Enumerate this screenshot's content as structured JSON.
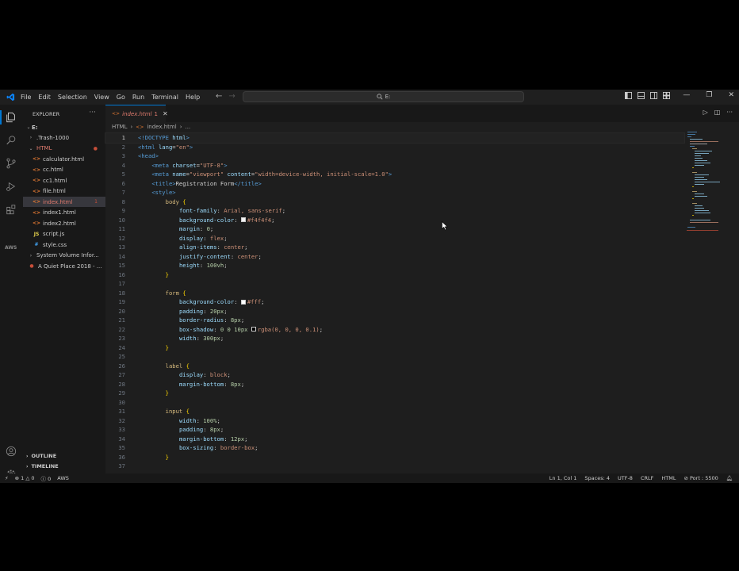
{
  "menu": [
    "File",
    "Edit",
    "Selection",
    "View",
    "Go",
    "Run",
    "Terminal",
    "Help"
  ],
  "search": {
    "text": "E:"
  },
  "colors": {
    "accent": "#0078d4",
    "modified": "#e07b6e",
    "html_icon": "#e37933",
    "js_icon": "#e8d44d",
    "css_icon": "#42a5f5",
    "tag": "#569cd6",
    "attr": "#9cdcfe",
    "string": "#ce9178",
    "property": "#9cdcfe",
    "value": "#ce9178",
    "number": "#b5cea8",
    "punct": "#808080",
    "selector": "#d7ba7d",
    "brace": "#ffd700"
  },
  "explorer": {
    "title": "EXPLORER",
    "more": "···",
    "root": "E:",
    "items": [
      {
        "label": ".Trash-1000",
        "type": "folder",
        "open": false,
        "indent": 1
      },
      {
        "label": "HTML",
        "type": "folder",
        "open": true,
        "indent": 1,
        "modified": true
      },
      {
        "label": "calculator.html",
        "type": "html",
        "indent": 2
      },
      {
        "label": "cc.html",
        "type": "html",
        "indent": 2
      },
      {
        "label": "cc1.html",
        "type": "html",
        "indent": 2
      },
      {
        "label": "file.html",
        "type": "html",
        "indent": 2
      },
      {
        "label": "index.html",
        "type": "html",
        "indent": 2,
        "selected": true,
        "badge": "1"
      },
      {
        "label": "index1.html",
        "type": "html",
        "indent": 2
      },
      {
        "label": "index2.html",
        "type": "html",
        "indent": 2
      },
      {
        "label": "script.js",
        "type": "js",
        "indent": 2
      },
      {
        "label": "style.css",
        "type": "css",
        "indent": 2
      },
      {
        "label": "System Volume Infor...",
        "type": "folder",
        "open": false,
        "indent": 1
      },
      {
        "label": "A Quiet Place 2018 - ...",
        "type": "video",
        "indent": 1
      }
    ],
    "outline": "OUTLINE",
    "timeline": "TIMELINE"
  },
  "tab": {
    "name": "index.html",
    "problems": "1",
    "close": "✕"
  },
  "breadcrumb": {
    "folder": "HTML",
    "sep": "›",
    "file": "index.html",
    "more": "..."
  },
  "code": [
    [
      [
        "tag",
        "<!DOCTYPE "
      ],
      [
        "attr",
        "html"
      ],
      [
        "tag",
        ">"
      ]
    ],
    [
      [
        "tag",
        "<html "
      ],
      [
        "attr",
        "lang"
      ],
      [
        "txt",
        "="
      ],
      [
        "string",
        "\"en\""
      ],
      [
        "tag",
        ">"
      ]
    ],
    [
      [
        "tag",
        "<head>"
      ]
    ],
    [
      [
        "txt",
        "    "
      ],
      [
        "tag",
        "<meta "
      ],
      [
        "attr",
        "charset"
      ],
      [
        "txt",
        "="
      ],
      [
        "string",
        "\"UTF-8\""
      ],
      [
        "tag",
        ">"
      ]
    ],
    [
      [
        "txt",
        "    "
      ],
      [
        "tag",
        "<meta "
      ],
      [
        "attr",
        "name"
      ],
      [
        "txt",
        "="
      ],
      [
        "string",
        "\"viewport\""
      ],
      [
        "txt",
        " "
      ],
      [
        "attr",
        "content"
      ],
      [
        "txt",
        "="
      ],
      [
        "string",
        "\"width=device-width, initial-scale=1.0\""
      ],
      [
        "tag",
        ">"
      ]
    ],
    [
      [
        "txt",
        "    "
      ],
      [
        "tag",
        "<title>"
      ],
      [
        "txt",
        "Registration Form"
      ],
      [
        "tag",
        "</title>"
      ]
    ],
    [
      [
        "txt",
        "    "
      ],
      [
        "tag",
        "<style>"
      ]
    ],
    [
      [
        "txt",
        "        "
      ],
      [
        "selector",
        "body"
      ],
      [
        "txt",
        " "
      ],
      [
        "brace",
        "{"
      ]
    ],
    [
      [
        "txt",
        "            "
      ],
      [
        "property",
        "font-family"
      ],
      [
        "txt",
        ": "
      ],
      [
        "value",
        "Arial, sans-serif"
      ],
      [
        "txt",
        ";"
      ]
    ],
    [
      [
        "txt",
        "            "
      ],
      [
        "property",
        "background-color"
      ],
      [
        "txt",
        ": "
      ],
      [
        "swatch",
        "#f4f4f4"
      ],
      [
        "value",
        "#f4f4f4"
      ],
      [
        "txt",
        ";"
      ]
    ],
    [
      [
        "txt",
        "            "
      ],
      [
        "property",
        "margin"
      ],
      [
        "txt",
        ": "
      ],
      [
        "number",
        "0"
      ],
      [
        "txt",
        ";"
      ]
    ],
    [
      [
        "txt",
        "            "
      ],
      [
        "property",
        "display"
      ],
      [
        "txt",
        ": "
      ],
      [
        "value",
        "flex"
      ],
      [
        "txt",
        ";"
      ]
    ],
    [
      [
        "txt",
        "            "
      ],
      [
        "property",
        "align-items"
      ],
      [
        "txt",
        ": "
      ],
      [
        "value",
        "center"
      ],
      [
        "txt",
        ";"
      ]
    ],
    [
      [
        "txt",
        "            "
      ],
      [
        "property",
        "justify-content"
      ],
      [
        "txt",
        ": "
      ],
      [
        "value",
        "center"
      ],
      [
        "txt",
        ";"
      ]
    ],
    [
      [
        "txt",
        "            "
      ],
      [
        "property",
        "height"
      ],
      [
        "txt",
        ": "
      ],
      [
        "number",
        "100vh"
      ],
      [
        "txt",
        ";"
      ]
    ],
    [
      [
        "txt",
        "        "
      ],
      [
        "brace",
        "}"
      ]
    ],
    [],
    [
      [
        "txt",
        "        "
      ],
      [
        "selector",
        "form"
      ],
      [
        "txt",
        " "
      ],
      [
        "brace",
        "{"
      ]
    ],
    [
      [
        "txt",
        "            "
      ],
      [
        "property",
        "background-color"
      ],
      [
        "txt",
        ": "
      ],
      [
        "swatch",
        "#fff"
      ],
      [
        "value",
        "#fff"
      ],
      [
        "txt",
        ";"
      ]
    ],
    [
      [
        "txt",
        "            "
      ],
      [
        "property",
        "padding"
      ],
      [
        "txt",
        ": "
      ],
      [
        "number",
        "20px"
      ],
      [
        "txt",
        ";"
      ]
    ],
    [
      [
        "txt",
        "            "
      ],
      [
        "property",
        "border-radius"
      ],
      [
        "txt",
        ": "
      ],
      [
        "number",
        "8px"
      ],
      [
        "txt",
        ";"
      ]
    ],
    [
      [
        "txt",
        "            "
      ],
      [
        "property",
        "box-shadow"
      ],
      [
        "txt",
        ": "
      ],
      [
        "number",
        "0 0 10px"
      ],
      [
        "txt",
        " "
      ],
      [
        "swatch",
        "#000000"
      ],
      [
        "value",
        "rgba(0, 0, 0, 0.1)"
      ],
      [
        "txt",
        ";"
      ]
    ],
    [
      [
        "txt",
        "            "
      ],
      [
        "property",
        "width"
      ],
      [
        "txt",
        ": "
      ],
      [
        "number",
        "300px"
      ],
      [
        "txt",
        ";"
      ]
    ],
    [
      [
        "txt",
        "        "
      ],
      [
        "brace",
        "}"
      ]
    ],
    [],
    [
      [
        "txt",
        "        "
      ],
      [
        "selector",
        "label"
      ],
      [
        "txt",
        " "
      ],
      [
        "brace",
        "{"
      ]
    ],
    [
      [
        "txt",
        "            "
      ],
      [
        "property",
        "display"
      ],
      [
        "txt",
        ": "
      ],
      [
        "value",
        "block"
      ],
      [
        "txt",
        ";"
      ]
    ],
    [
      [
        "txt",
        "            "
      ],
      [
        "property",
        "margin-bottom"
      ],
      [
        "txt",
        ": "
      ],
      [
        "number",
        "8px"
      ],
      [
        "txt",
        ";"
      ]
    ],
    [
      [
        "txt",
        "        "
      ],
      [
        "brace",
        "}"
      ]
    ],
    [],
    [
      [
        "txt",
        "        "
      ],
      [
        "selector",
        "input"
      ],
      [
        "txt",
        " "
      ],
      [
        "brace",
        "{"
      ]
    ],
    [
      [
        "txt",
        "            "
      ],
      [
        "property",
        "width"
      ],
      [
        "txt",
        ": "
      ],
      [
        "number",
        "100%"
      ],
      [
        "txt",
        ";"
      ]
    ],
    [
      [
        "txt",
        "            "
      ],
      [
        "property",
        "padding"
      ],
      [
        "txt",
        ": "
      ],
      [
        "number",
        "8px"
      ],
      [
        "txt",
        ";"
      ]
    ],
    [
      [
        "txt",
        "            "
      ],
      [
        "property",
        "margin-bottom"
      ],
      [
        "txt",
        ": "
      ],
      [
        "number",
        "12px"
      ],
      [
        "txt",
        ";"
      ]
    ],
    [
      [
        "txt",
        "            "
      ],
      [
        "property",
        "box-sizing"
      ],
      [
        "txt",
        ": "
      ],
      [
        "value",
        "border-box"
      ],
      [
        "txt",
        ";"
      ]
    ],
    [
      [
        "txt",
        "        "
      ],
      [
        "brace",
        "}"
      ]
    ],
    []
  ],
  "current_line": 1,
  "status": {
    "errors": "1",
    "warnings": "0",
    "info": "0",
    "aws": "AWS",
    "position": "Ln 1, Col 1",
    "spaces": "Spaces: 4",
    "encoding": "UTF-8",
    "eol": "CRLF",
    "language": "HTML",
    "port": "Port : 5500"
  }
}
